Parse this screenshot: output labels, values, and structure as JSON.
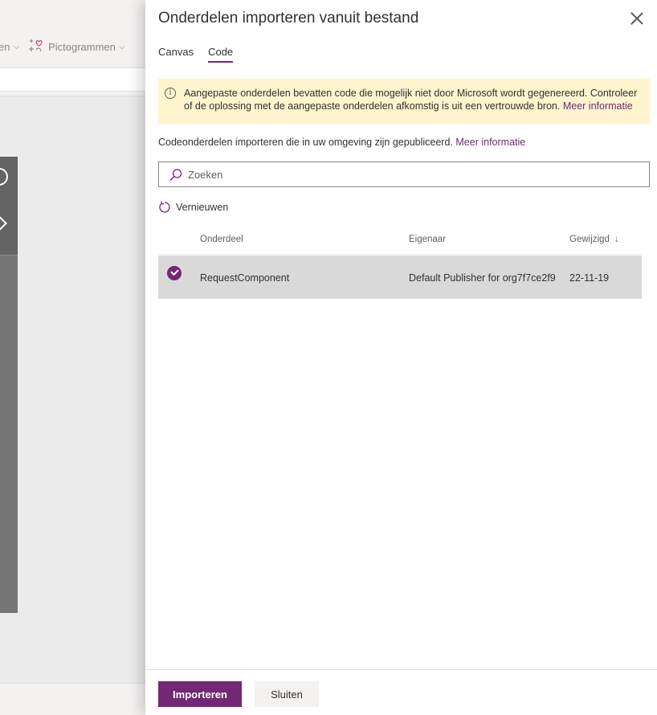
{
  "background": {
    "toolbar_partial_label": "en",
    "icons_menu_label": "Pictogrammen"
  },
  "panel": {
    "title": "Onderdelen importeren vanuit bestand",
    "tabs": [
      {
        "label": "Canvas",
        "active": false
      },
      {
        "label": "Code",
        "active": true
      }
    ],
    "warning": {
      "text": "Aangepaste onderdelen bevatten code die mogelijk niet door Microsoft wordt gegenereerd. Controleer of de oplossing met de aangepaste onderdelen afkomstig is uit een vertrouwde bron.",
      "link": "Meer informatie"
    },
    "description": {
      "text": "Codeonderdelen importeren die in uw omgeving zijn gepubliceerd.",
      "link": "Meer informatie"
    },
    "search": {
      "placeholder": "Zoeken",
      "value": ""
    },
    "refresh_label": "Vernieuwen",
    "table": {
      "columns": {
        "name": "Onderdeel",
        "owner": "Eigenaar",
        "modified": "Gewijzigd"
      },
      "sort": {
        "column": "modified",
        "direction": "descending"
      },
      "rows": [
        {
          "name": "RequestComponent",
          "owner": "Default Publisher for org7f7ce2f9",
          "modified": "22-11-19",
          "selected": true
        }
      ]
    },
    "footer": {
      "primary_label": "Importeren",
      "secondary_label": "Sluiten"
    }
  },
  "colors": {
    "accent": "#742774",
    "warning_bg": "#fff4ce",
    "selected_row": "#d9d9d9"
  }
}
